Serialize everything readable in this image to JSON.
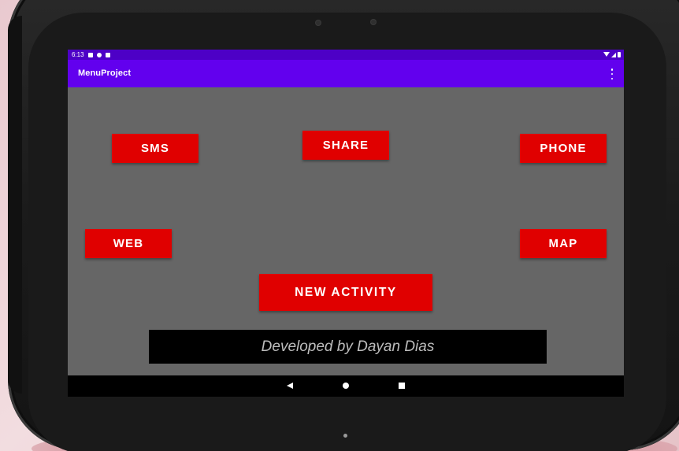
{
  "status_bar": {
    "time": "6:13",
    "left_icons": [
      "notification-icon",
      "sync-icon",
      "sd-card-icon"
    ],
    "right_icons": [
      "wifi-icon",
      "signal-icon",
      "battery-icon"
    ]
  },
  "app_bar": {
    "title": "MenuProject",
    "overflow_icon": "more-vert-icon"
  },
  "buttons": {
    "sms": "SMS",
    "share": "SHARE",
    "phone": "PHONE",
    "web": "WEB",
    "map": "MAP",
    "new_activity": "NEW ACTIVITY"
  },
  "footer": {
    "text": "Developed by Dayan Dias"
  },
  "nav_bar": {
    "back_icon": "back-icon",
    "home_icon": "home-icon",
    "recents_icon": "recents-icon"
  },
  "colors": {
    "status_bar": "#4d00c6",
    "app_bar": "#6200ee",
    "content_background": "#666666",
    "button": "#e00000",
    "button_text": "#ffffff",
    "footer_background": "#000000",
    "footer_text": "#bdbdbd"
  }
}
